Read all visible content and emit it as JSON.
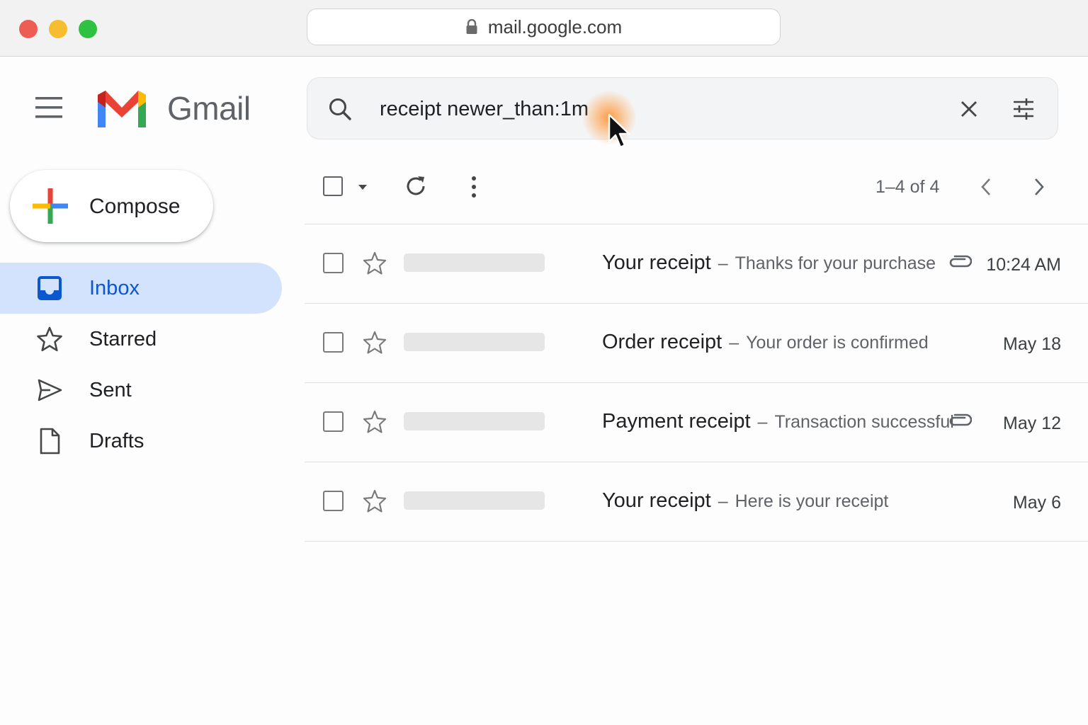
{
  "browser": {
    "url": "mail.google.com"
  },
  "header": {
    "app_name": "Gmail"
  },
  "search": {
    "value": "receipt newer_than:1m"
  },
  "sidebar": {
    "compose_label": "Compose",
    "items": [
      {
        "label": "Inbox",
        "icon": "inbox-icon",
        "active": true
      },
      {
        "label": "Starred",
        "icon": "star-icon",
        "active": false
      },
      {
        "label": "Sent",
        "icon": "send-icon",
        "active": false
      },
      {
        "label": "Drafts",
        "icon": "draft-icon",
        "active": false
      }
    ]
  },
  "toolbar": {
    "count": "1–4 of 4"
  },
  "emails": [
    {
      "subject": "Your receipt",
      "separator": "–",
      "snippet": "Thanks for your purchase",
      "attachment": true,
      "date": "10:24 AM"
    },
    {
      "subject": "Order receipt",
      "separator": "–",
      "snippet": "Your order is confirmed",
      "attachment": false,
      "date": "May 18"
    },
    {
      "subject": "Payment receipt",
      "separator": "–",
      "snippet": "Transaction successful",
      "attachment": true,
      "date": "May 12"
    },
    {
      "subject": "Your receipt",
      "separator": "–",
      "snippet": "Here is your receipt",
      "attachment": false,
      "date": "May 6"
    }
  ],
  "colors": {
    "active_nav_bg": "#d3e3fd",
    "active_nav_text": "#0b57d0",
    "gmail_red": "#ea4335",
    "gmail_blue": "#4285f4",
    "gmail_green": "#34a853",
    "gmail_yellow": "#fbbc04"
  }
}
